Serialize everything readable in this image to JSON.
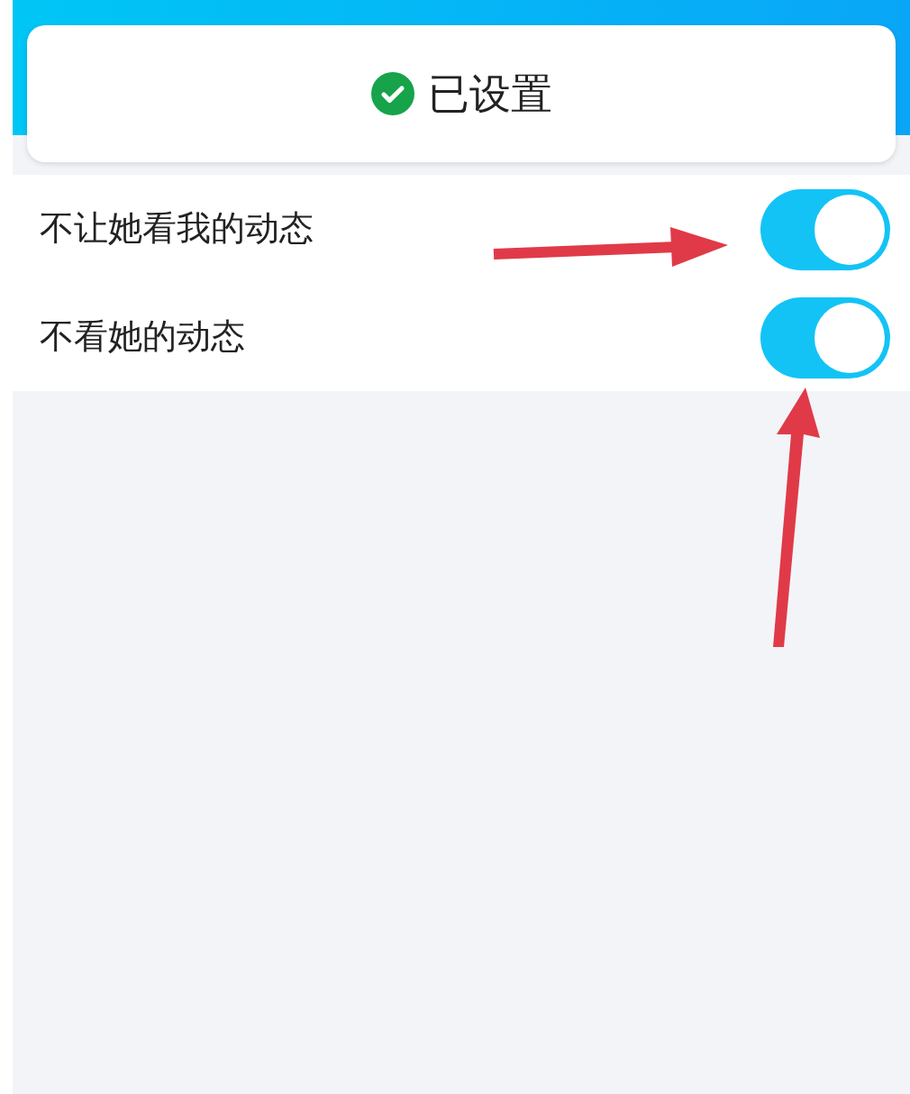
{
  "toast": {
    "text": "已设置"
  },
  "settings": [
    {
      "label": "不让她看我的动态",
      "on": true
    },
    {
      "label": "不看她的动态",
      "on": true
    }
  ]
}
